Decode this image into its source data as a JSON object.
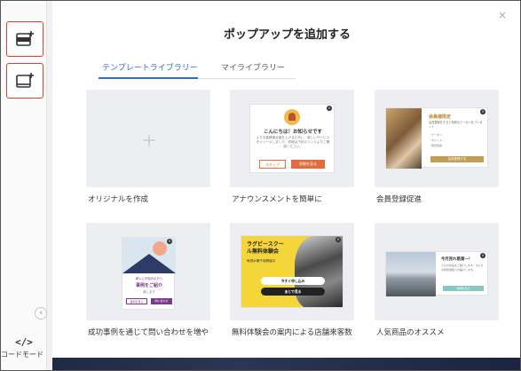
{
  "title": "ポップアップを追加する",
  "tabs": [
    {
      "label": "テンプレートライブラリー",
      "active": true
    },
    {
      "label": "マイライブラリー",
      "active": false
    }
  ],
  "sidebar": {
    "code_mode_icon": "</>",
    "code_mode_label": "コードモード",
    "collapse_glyph": "‹"
  },
  "close_glyph": "×",
  "templates": [
    {
      "label": "オリジナルを作成"
    },
    {
      "label": "アナウンスメントを簡単に",
      "preview": {
        "heading": "こんにちは！お知らせです",
        "body": "よりお客様満足度を上げるために、新しいサービスをリリースしました。詳細は下記のリンクよりご確認ください。",
        "skip": "スキップ",
        "more": "詳細を見る"
      }
    },
    {
      "label": "会員登録促進",
      "preview": {
        "heading": "会員様限定",
        "body": "会員登録をすると特別なクーポンをプレゼント",
        "lines": [
          "・クーポン",
          "・ポイント",
          "・限定情報"
        ],
        "button": "会員登録する"
      }
    },
    {
      "label": "成功事例を通じて問い合わせを増や",
      "preview": {
        "line1": "導入にお悩みの方へ",
        "line2": "事例をご紹介",
        "line3": "致します",
        "btn1": "事例を見る",
        "btn2": "問い合わせ"
      }
    },
    {
      "label": "無料体験会の案内による店舗来客数",
      "preview": {
        "heading_line1": "ラグビースクー",
        "heading_line2": "ル無料体験会",
        "sub": "毎週水曜午後開催中",
        "btn1": "今すぐ申し込み",
        "btn2": "あとで見る"
      }
    },
    {
      "label": "人気商品のオススメ",
      "preview": {
        "heading": "今月売れ筋第一！",
        "body": "人気の商品をご紹介します。今だけの特別価格でお届けします。",
        "button": "詳細を見る"
      }
    }
  ],
  "colors": {
    "accent_tab": "#2b6fcf",
    "highlight_border": "#d9432b",
    "announce_orange": "#e36b3f",
    "member_gold": "#c29d55",
    "success_purple": "#7a3a8a",
    "rugby_yellow": "#f5d63a",
    "popular_teal": "#8cc6c2"
  },
  "icons": [
    "add-popup-icon",
    "add-popup-alt-icon",
    "chevron-left-icon",
    "code-icon",
    "close-icon",
    "plus-icon",
    "bell-icon"
  ]
}
